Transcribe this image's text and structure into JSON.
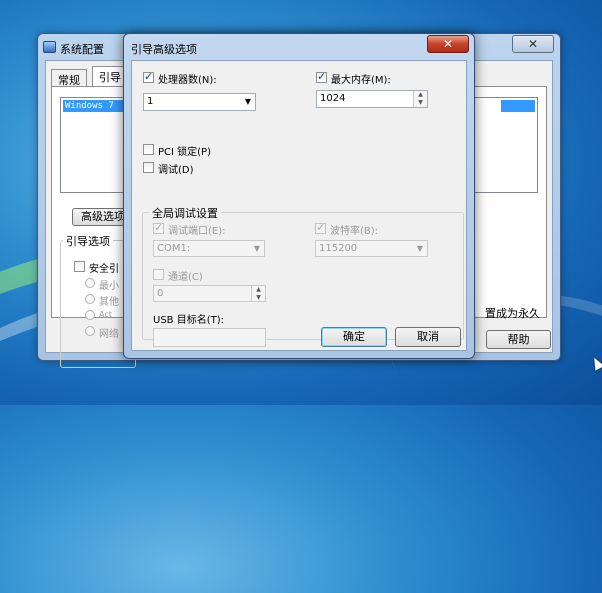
{
  "background_window": {
    "title": "系统配置",
    "close_glyph": "✕",
    "tabs": [
      "常规",
      "引导"
    ],
    "os_list": [
      "Windows 7"
    ],
    "advanced_button": "高级选项",
    "boot_options_label": "引导选项",
    "safe_boot_label": "安全引",
    "radio_labels": [
      "最小",
      "其他",
      "Act",
      "网络"
    ],
    "make_permanent_label": "置成为永久",
    "help_button": "帮助"
  },
  "dialog": {
    "title": "引导高级选项",
    "close_glyph": "✕",
    "num_processors": {
      "label": "处理器数(N):",
      "checked": true,
      "value": "1"
    },
    "max_memory": {
      "label": "最大内存(M):",
      "checked": true,
      "value": "1024"
    },
    "pci_lock": {
      "label": "PCI 锁定(P)",
      "checked": false
    },
    "debug": {
      "label": "调试(D)",
      "checked": false
    },
    "global_debug": {
      "legend": "全局调试设置",
      "debug_port": {
        "label": "调试端口(E):",
        "checked": true,
        "value": "COM1:"
      },
      "baud_rate": {
        "label": "波特率(B):",
        "checked": true,
        "value": "115200"
      },
      "channel": {
        "label": "通道(C)",
        "checked": false,
        "value": "0"
      },
      "usb_target": {
        "label": "USB 目标名(T):",
        "value": ""
      }
    },
    "ok_button": "确定",
    "cancel_button": "取消"
  }
}
